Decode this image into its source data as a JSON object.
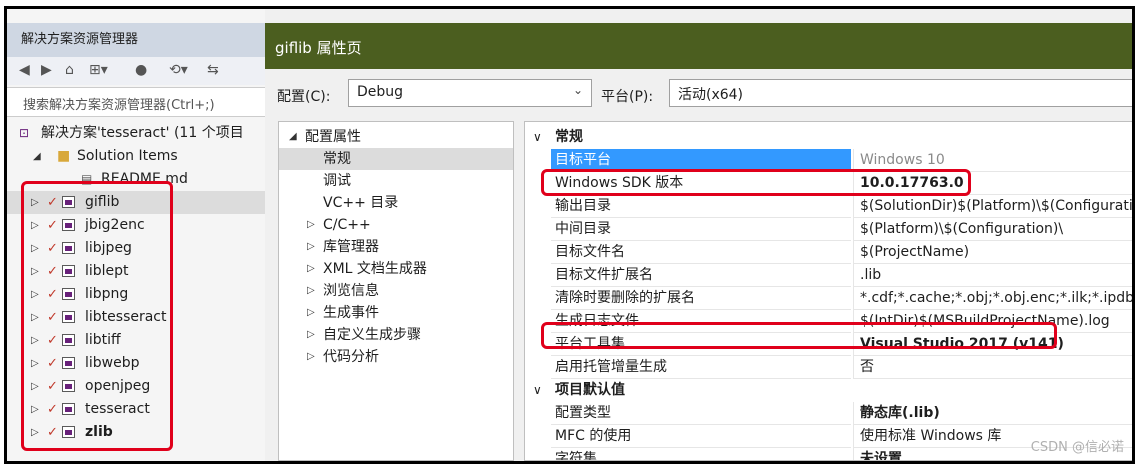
{
  "solution_explorer": {
    "title": "解决方案资源管理器",
    "search_placeholder": "搜索解决方案资源管理器(Ctrl+;)",
    "solution_label": "解决方案'tesseract' (11 个项目",
    "solution_items_label": "Solution Items",
    "readme_label": "README.md",
    "projects": [
      "giflib",
      "jbig2enc",
      "libjpeg",
      "liblept",
      "libpng",
      "libtesseract",
      "libtiff",
      "libwebp",
      "openjpeg",
      "tesseract",
      "zlib"
    ]
  },
  "property_pages": {
    "title": "giflib 属性页",
    "config_label": "配置(C):",
    "config_value": "Debug",
    "platform_label": "平台(P):",
    "platform_value": "活动(x64)",
    "nav": {
      "root": "配置属性",
      "items": [
        "常规",
        "调试",
        "VC++ 目录",
        "C/C++",
        "库管理器",
        "XML 文档生成器",
        "浏览信息",
        "生成事件",
        "自定义生成步骤",
        "代码分析"
      ]
    },
    "grid": {
      "category1": "常规",
      "rows1": [
        {
          "name": "目标平台",
          "value": "Windows 10"
        },
        {
          "name": "Windows SDK 版本",
          "value": "10.0.17763.0"
        },
        {
          "name": "输出目录",
          "value": "$(SolutionDir)$(Platform)\\$(Configuration)\\"
        },
        {
          "name": "中间目录",
          "value": "$(Platform)\\$(Configuration)\\"
        },
        {
          "name": "目标文件名",
          "value": "$(ProjectName)"
        },
        {
          "name": "目标文件扩展名",
          "value": ".lib"
        },
        {
          "name": "清除时要删除的扩展名",
          "value": "*.cdf;*.cache;*.obj;*.obj.enc;*.ilk;*.ipdb"
        },
        {
          "name": "生成日志文件",
          "value": "$(IntDir)$(MSBuildProjectName).log"
        },
        {
          "name": "平台工具集",
          "value": "Visual Studio 2017 (v141)"
        },
        {
          "name": "启用托管增量生成",
          "value": "否"
        }
      ],
      "category2": "项目默认值",
      "rows2": [
        {
          "name": "配置类型",
          "value": "静态库(.lib)"
        },
        {
          "name": "MFC 的使用",
          "value": "使用标准 Windows 库"
        },
        {
          "name": "字符集",
          "value": "未设置"
        }
      ]
    }
  },
  "watermark": "CSDN @信必诺",
  "colors": {
    "title_bar": "#4b5e1f",
    "selection": "#3399ff",
    "highlight_box": "#e0001b"
  }
}
